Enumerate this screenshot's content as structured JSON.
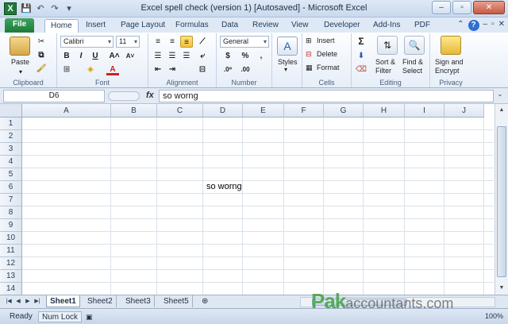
{
  "window": {
    "title": "Excel spell check (version 1) [Autosaved]  -  Microsoft Excel",
    "app_icon": "X",
    "controls": [
      "–",
      "▫",
      "✕"
    ]
  },
  "tabs": [
    "File",
    "Home",
    "Insert",
    "Page Layout",
    "Formulas",
    "Data",
    "Review",
    "View",
    "Developer",
    "Add-Ins",
    "PDF"
  ],
  "ribbon": {
    "clipboard": {
      "label": "Clipboard",
      "paste": "Paste"
    },
    "font": {
      "label": "Font",
      "name": "Calibri",
      "size": "11",
      "bold": "B",
      "italic": "I",
      "underline": "U"
    },
    "alignment": {
      "label": "Alignment"
    },
    "number": {
      "label": "Number",
      "format": "General",
      "currency": "$",
      "percent": "%",
      "comma": ","
    },
    "styles": {
      "label": "Styles"
    },
    "cells": {
      "label": "Cells",
      "insert": "Insert",
      "delete": "Delete",
      "format": "Format"
    },
    "editing": {
      "label": "Editing",
      "sum": "Σ",
      "sort1": "Sort &",
      "sort2": "Filter",
      "find1": "Find &",
      "find2": "Select"
    },
    "privacy": {
      "label": "Privacy",
      "sign1": "Sign and",
      "sign2": "Encrypt"
    }
  },
  "formula_bar": {
    "name_box": "D6",
    "fx": "fx",
    "value": "so worng"
  },
  "columns": [
    "A",
    "B",
    "C",
    "D",
    "E",
    "F",
    "G",
    "H",
    "I",
    "J"
  ],
  "rows": [
    "1",
    "2",
    "3",
    "4",
    "5",
    "6",
    "7",
    "8",
    "9",
    "10",
    "11",
    "12",
    "13",
    "14"
  ],
  "cells": {
    "D6": "so worng"
  },
  "sheets": [
    "Sheet1",
    "Sheet2",
    "Sheet3",
    "Sheet5"
  ],
  "active_sheet": "Sheet1",
  "status": {
    "ready": "Ready",
    "numlock": "Num Lock",
    "zoom": "100%"
  },
  "watermark": {
    "brand": "Pak",
    "rest": "accountants.com"
  },
  "colors": {
    "accent": "#1e7a3a",
    "ribbon_bg": "#e6eef8",
    "header_bg": "#dde6f1"
  }
}
